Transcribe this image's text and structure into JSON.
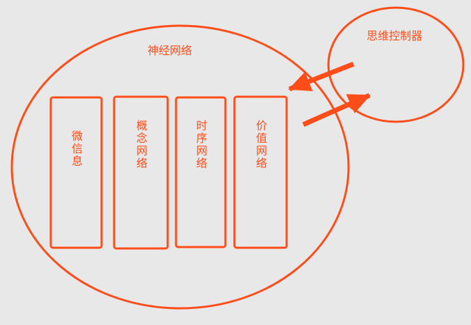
{
  "colors": {
    "stroke": "#ff4d1a",
    "text": "#ff4d1a",
    "background": "#e8e8e8"
  },
  "diagram": {
    "main_label": "神经网络",
    "controller_label": "思维控制器",
    "modules": [
      {
        "label": "微信息"
      },
      {
        "label": "概念网络"
      },
      {
        "label": "时序网络"
      },
      {
        "label": "价值网络"
      }
    ],
    "arrows": [
      {
        "direction": "controller-to-network"
      },
      {
        "direction": "network-to-controller"
      }
    ]
  }
}
